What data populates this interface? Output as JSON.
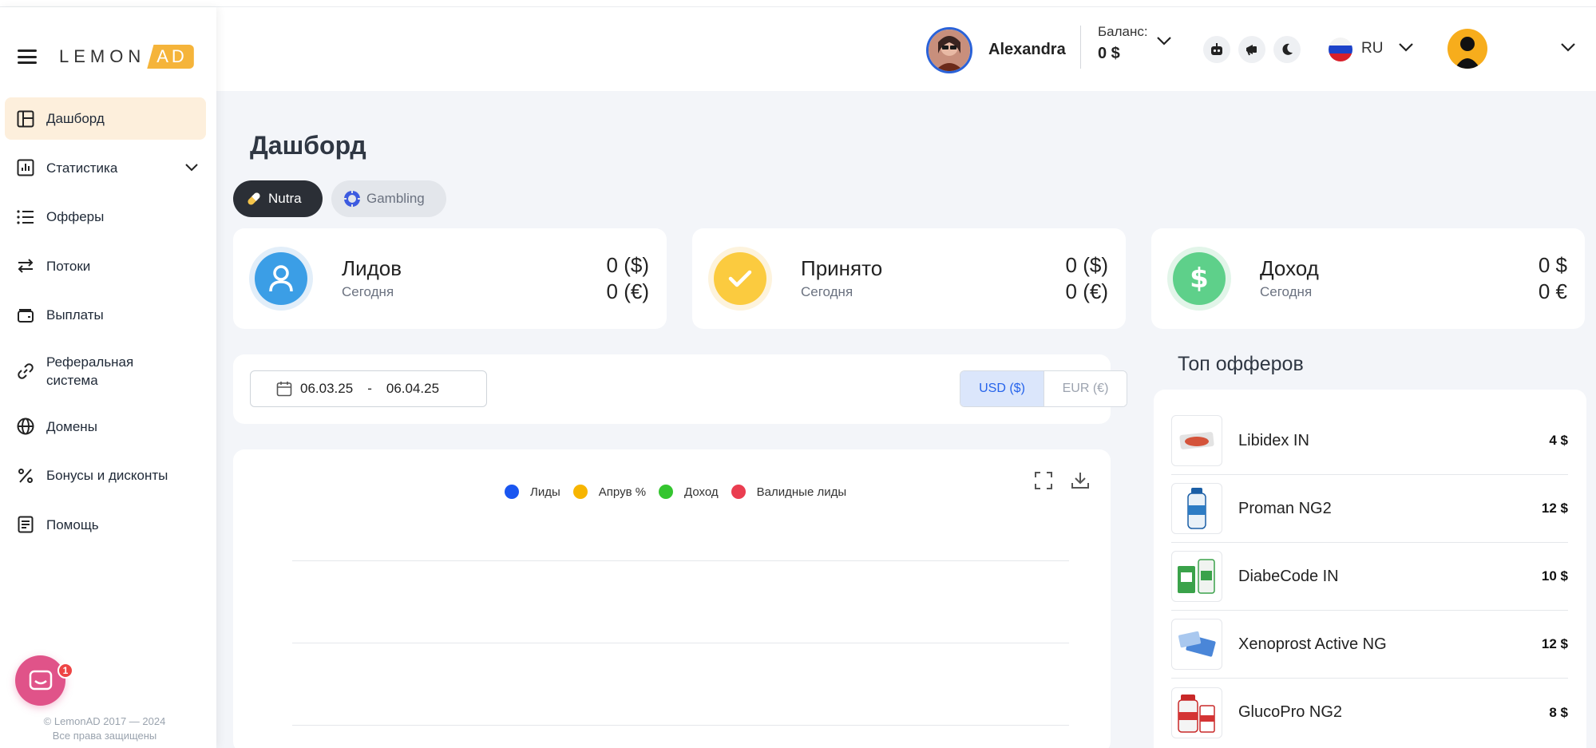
{
  "brand": {
    "logo_main": "LEMON",
    "logo_accent": "AD"
  },
  "sidebar": {
    "items": [
      {
        "label": "Дашборд",
        "icon": "layout-icon",
        "active": true
      },
      {
        "label": "Статистика",
        "icon": "bar-chart-icon",
        "has_chevron": true
      },
      {
        "label": "Офферы",
        "icon": "list-icon"
      },
      {
        "label": "Потоки",
        "icon": "arrows-exchange-icon"
      },
      {
        "label": "Выплаты",
        "icon": "wallet-icon"
      },
      {
        "label": "Реферальная система",
        "icon": "link-icon"
      },
      {
        "label": "Домены",
        "icon": "globe-icon"
      },
      {
        "label": "Бонусы и дисконты",
        "icon": "percent-icon"
      },
      {
        "label": "Помощь",
        "icon": "receipt-icon"
      }
    ],
    "chat_badge": "1",
    "copyright_line1": "© LemonAD 2017 — 2024",
    "copyright_line2": "Все права защищены"
  },
  "header": {
    "user_name": "Alexandra",
    "balance_label": "Баланс:",
    "balance_value": "0 $",
    "language": "RU"
  },
  "page": {
    "title": "Дашборд",
    "verticals": [
      {
        "label": "Nutra",
        "active": true
      },
      {
        "label": "Gambling",
        "active": false
      }
    ]
  },
  "stats": [
    {
      "title": "Лидов",
      "subtitle": "Сегодня",
      "value1": "0 ($)",
      "value2": "0 (€)",
      "color": "#3b9ee6"
    },
    {
      "title": "Принято",
      "subtitle": "Сегодня",
      "value1": "0 ($)",
      "value2": "0 (€)",
      "color": "#fbcb3f"
    },
    {
      "title": "Доход",
      "subtitle": "Сегодня",
      "value1": "0 $",
      "value2": "0 €",
      "color": "#5ed08a"
    }
  ],
  "filters": {
    "date_from": "06.03.25",
    "date_sep": "-",
    "date_to": "06.04.25",
    "currencies": [
      {
        "label": "USD ($)",
        "active": true
      },
      {
        "label": "EUR (€)",
        "active": false
      }
    ]
  },
  "chart_data": {
    "type": "line",
    "series": [
      {
        "name": "Лиды",
        "color": "#1a56f0",
        "values": []
      },
      {
        "name": "Апрув %",
        "color": "#f7b500",
        "values": []
      },
      {
        "name": "Доход",
        "color": "#34c52f",
        "values": []
      },
      {
        "name": "Валидные лиды",
        "color": "#ea3d50",
        "values": []
      }
    ],
    "grid": true,
    "legend_position": "top-center"
  },
  "top_offers": {
    "title": "Топ офферов",
    "items": [
      {
        "name": "Libidex IN",
        "price": "4 $"
      },
      {
        "name": "Proman NG2",
        "price": "12 $"
      },
      {
        "name": "DiabeCode IN",
        "price": "10 $"
      },
      {
        "name": "Xenoprost Active NG",
        "price": "12 $"
      },
      {
        "name": "GlucoPro NG2",
        "price": "8 $"
      }
    ]
  }
}
